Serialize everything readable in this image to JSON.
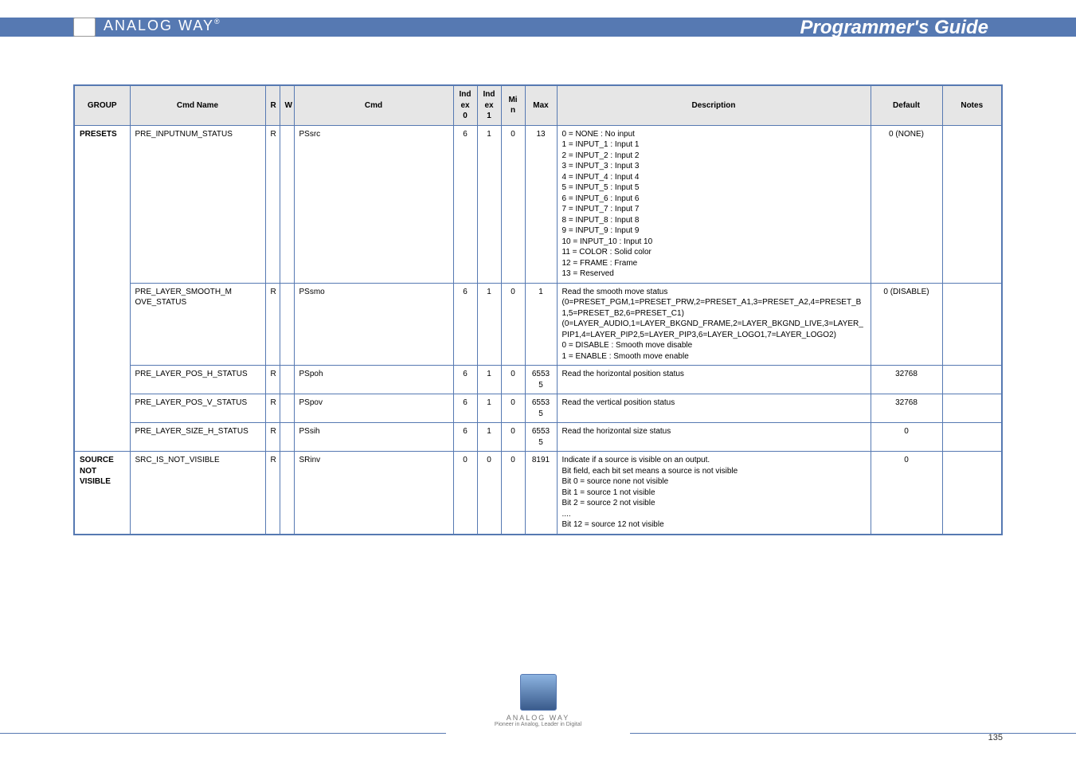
{
  "brand": {
    "name": "ANALOG WAY",
    "reg": "®",
    "tagline": "Pioneer in Analog, Leader in Digital"
  },
  "header": {
    "title": "Programmer's Guide"
  },
  "page_number": "135",
  "columns": [
    "GROUP",
    "Cmd Name",
    "R",
    "W",
    "Cmd",
    "Index 0",
    "Index 1",
    "Min",
    "Max",
    "Description",
    "Default",
    "Notes"
  ],
  "rows": [
    {
      "group": "PRESETS",
      "group_rowspan": 5,
      "cmd_name": "PRE_INPUTNUM_STATUS",
      "r": "R",
      "w": "",
      "cmd": "PSsrc",
      "idx0": "6",
      "idx1": "1",
      "min": "0",
      "max": "13",
      "desc": [
        "0 = NONE : No input",
        "1 = INPUT_1 : Input 1",
        "2 = INPUT_2 : Input 2",
        "3 = INPUT_3 : Input 3",
        "4 = INPUT_4 : Input 4",
        "5 = INPUT_5 : Input 5",
        "6 = INPUT_6 : Input 6",
        "7 = INPUT_7 : Input 7",
        "8 = INPUT_8 : Input 8",
        "9 = INPUT_9 : Input 9",
        "10 = INPUT_10 : Input 10",
        "11 = COLOR : Solid color",
        "12 = FRAME : Frame",
        "13 = Reserved"
      ],
      "def": "0 (NONE)",
      "notes": ""
    },
    {
      "cmd_name": "PRE_LAYER_SMOOTH_M OVE_STATUS",
      "r": "R",
      "w": "",
      "cmd": "PSsmo",
      "idx0": "6",
      "idx1": "1",
      "min": "0",
      "max": "1",
      "desc": [
        "Read the smooth move status",
        "(0=PRESET_PGM,1=PRESET_PRW,2=PRESET_A1,3=PRESET_A2,4=PRESET_B1,5=PRESET_B2,6=PRESET_C1)",
        "(0=LAYER_AUDIO,1=LAYER_BKGND_FRAME,2=LAYER_BKGND_LIVE,3=LAYER_PIP1,4=LAYER_PIP2,5=LAYER_PIP3,6=LAYER_LOGO1,7=LAYER_LOGO2)",
        "0 = DISABLE : Smooth move disable",
        "1 = ENABLE : Smooth move enable"
      ],
      "def": "0 (DISABLE)",
      "notes": ""
    },
    {
      "cmd_name": "PRE_LAYER_POS_H_STATUS",
      "r": "R",
      "w": "",
      "cmd": "PSpoh",
      "idx0": "6",
      "idx1": "1",
      "min": "0",
      "max": "65535",
      "desc": [
        "Read the horizontal position status"
      ],
      "def": "32768",
      "notes": ""
    },
    {
      "cmd_name": "PRE_LAYER_POS_V_STATUS",
      "r": "R",
      "w": "",
      "cmd": "PSpov",
      "idx0": "6",
      "idx1": "1",
      "min": "0",
      "max": "65535",
      "desc": [
        "Read the vertical position status"
      ],
      "def": "32768",
      "notes": ""
    },
    {
      "cmd_name": "PRE_LAYER_SIZE_H_STATUS",
      "r": "R",
      "w": "",
      "cmd": "PSsih",
      "idx0": "6",
      "idx1": "1",
      "min": "0",
      "max": "65535",
      "desc": [
        "Read the horizontal size status"
      ],
      "def": "0",
      "notes": ""
    },
    {
      "group": "SOURCE NOT VISIBLE",
      "group_rowspan": 1,
      "cmd_name": "SRC_IS_NOT_VISIBLE",
      "r": "R",
      "w": "",
      "cmd": "SRinv",
      "idx0": "0",
      "idx1": "0",
      "min": "0",
      "max": "8191",
      "desc": [
        "Indicate if a source is visible on an output.",
        "Bit field, each bit set means a source is not visible",
        "Bit 0  = source none not visible",
        "Bit 1  = source 1 not visible",
        "Bit 2  = source 2 not visible",
        "....",
        "Bit 12 = source 12 not visible"
      ],
      "def": "0",
      "notes": ""
    }
  ]
}
